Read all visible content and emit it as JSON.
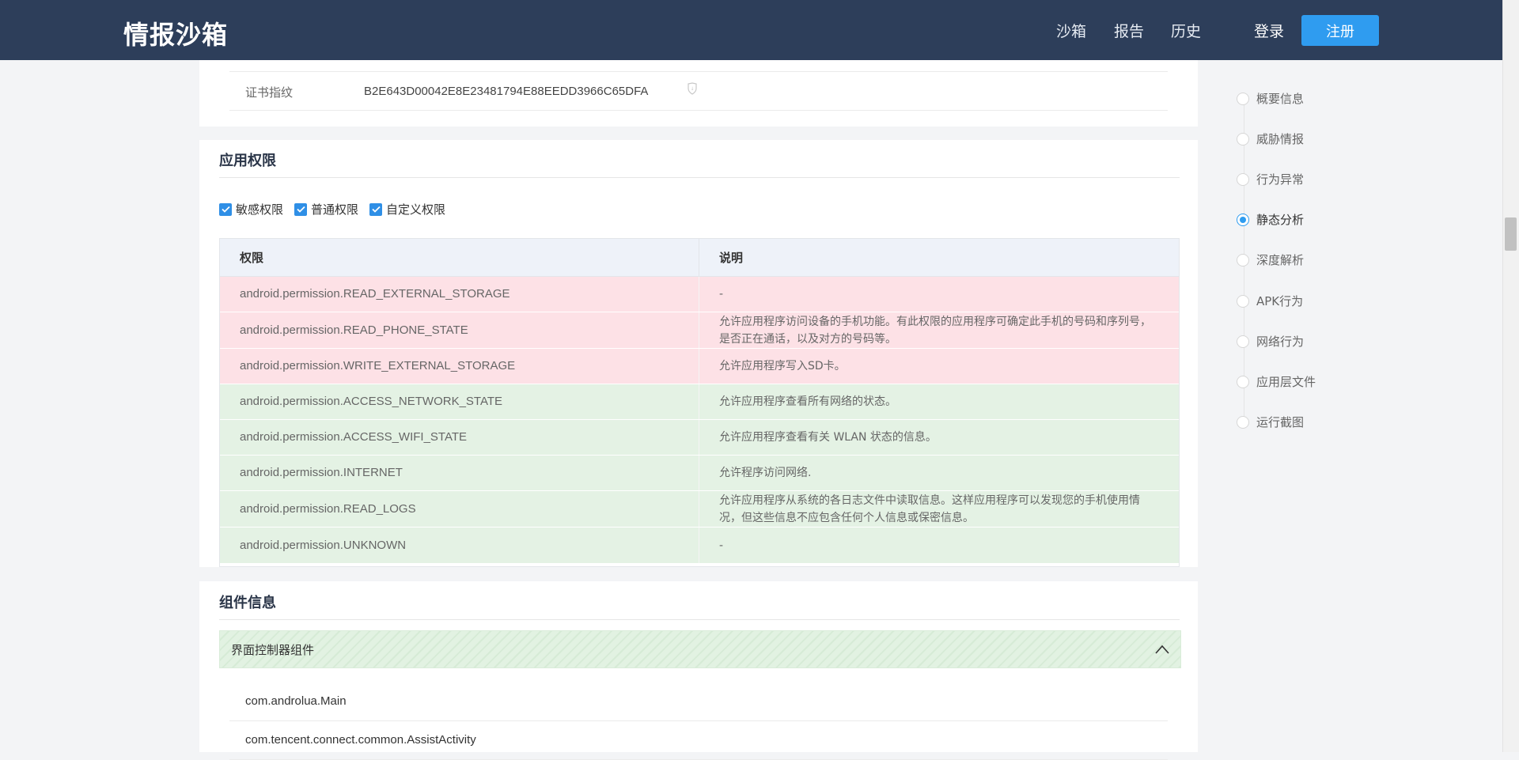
{
  "header": {
    "logo": "情报沙箱",
    "nav": {
      "sandbox": "沙箱",
      "report": "报告",
      "history": "历史"
    },
    "login": "登录",
    "register": "注册"
  },
  "cert": {
    "label": "证书指纹",
    "value": "B2E643D00042E8E23481794E88EEDD3966C65DFA"
  },
  "permissions": {
    "title": "应用权限",
    "filters": [
      "敏感权限",
      "普通权限",
      "自定义权限"
    ],
    "columns": [
      "权限",
      "说明"
    ],
    "rows": [
      {
        "name": "android.permission.READ_EXTERNAL_STORAGE",
        "desc": "-",
        "level": "sensitive"
      },
      {
        "name": "android.permission.READ_PHONE_STATE",
        "desc": "允许应用程序访问设备的手机功能。有此权限的应用程序可确定此手机的号码和序列号，是否正在通话，以及对方的号码等。",
        "level": "sensitive"
      },
      {
        "name": "android.permission.WRITE_EXTERNAL_STORAGE",
        "desc": "允许应用程序写入SD卡。",
        "level": "sensitive"
      },
      {
        "name": "android.permission.ACCESS_NETWORK_STATE",
        "desc": "允许应用程序查看所有网络的状态。",
        "level": "normal"
      },
      {
        "name": "android.permission.ACCESS_WIFI_STATE",
        "desc": "允许应用程序查看有关 WLAN 状态的信息。",
        "level": "normal"
      },
      {
        "name": "android.permission.INTERNET",
        "desc": "允许程序访问网络.",
        "level": "normal"
      },
      {
        "name": "android.permission.READ_LOGS",
        "desc": "允许应用程序从系统的各日志文件中读取信息。这样应用程序可以发现您的手机使用情况，但这些信息不应包含任何个人信息或保密信息。",
        "level": "normal"
      },
      {
        "name": "android.permission.UNKNOWN",
        "desc": "-",
        "level": "normal"
      }
    ]
  },
  "components": {
    "title": "组件信息",
    "accordion_label": "界面控制器组件",
    "items": [
      "com.androlua.Main",
      "com.tencent.connect.common.AssistActivity"
    ]
  },
  "side_nav": {
    "items": [
      "概要信息",
      "威胁情报",
      "行为异常",
      "静态分析",
      "深度解析",
      "APK行为",
      "网络行为",
      "应用层文件",
      "运行截图"
    ],
    "active": "静态分析"
  },
  "colors": {
    "header_bg": "#2d3e5a",
    "accent": "#2f9cf0",
    "sensitive_row": "#fde1e6",
    "normal_row": "#e4f2e4"
  }
}
